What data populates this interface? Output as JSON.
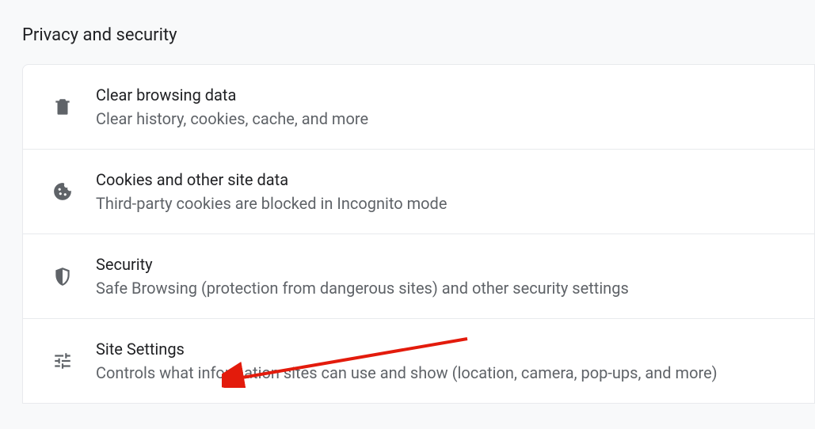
{
  "header": {
    "title": "Privacy and security"
  },
  "items": [
    {
      "title": "Clear browsing data",
      "desc": "Clear history, cookies, cache, and more"
    },
    {
      "title": "Cookies and other site data",
      "desc": "Third-party cookies are blocked in Incognito mode"
    },
    {
      "title": "Security",
      "desc": "Safe Browsing (protection from dangerous sites) and other security settings"
    },
    {
      "title": "Site Settings",
      "desc": "Controls what information sites can use and show (location, camera, pop-ups, and more)"
    }
  ]
}
